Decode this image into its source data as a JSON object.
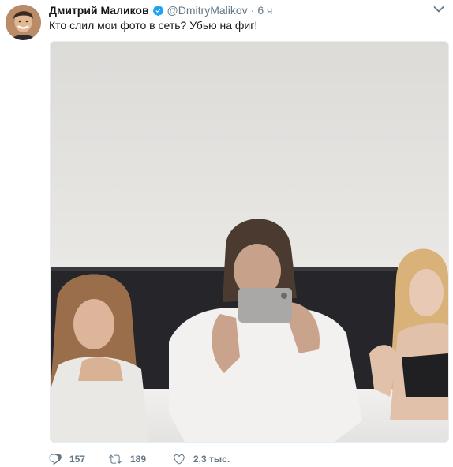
{
  "tweet": {
    "author": {
      "display_name": "Дмитрий Маликов",
      "verified": true,
      "handle": "@DmitryMalikov",
      "time_separator": "·",
      "time": "6 ч",
      "avatar_icon": "avatar-photo"
    },
    "text": "Кто слил мои фото в сеть? Убью на фиг!",
    "media": {
      "type": "photo",
      "description_icon": "tweet-photo"
    },
    "actions": {
      "reply_count": "157",
      "retweet_count": "189",
      "like_count": "2,3 тыс."
    },
    "colors": {
      "text": "#14171a",
      "secondary": "#657786",
      "verified_blue": "#1da1f2"
    }
  }
}
